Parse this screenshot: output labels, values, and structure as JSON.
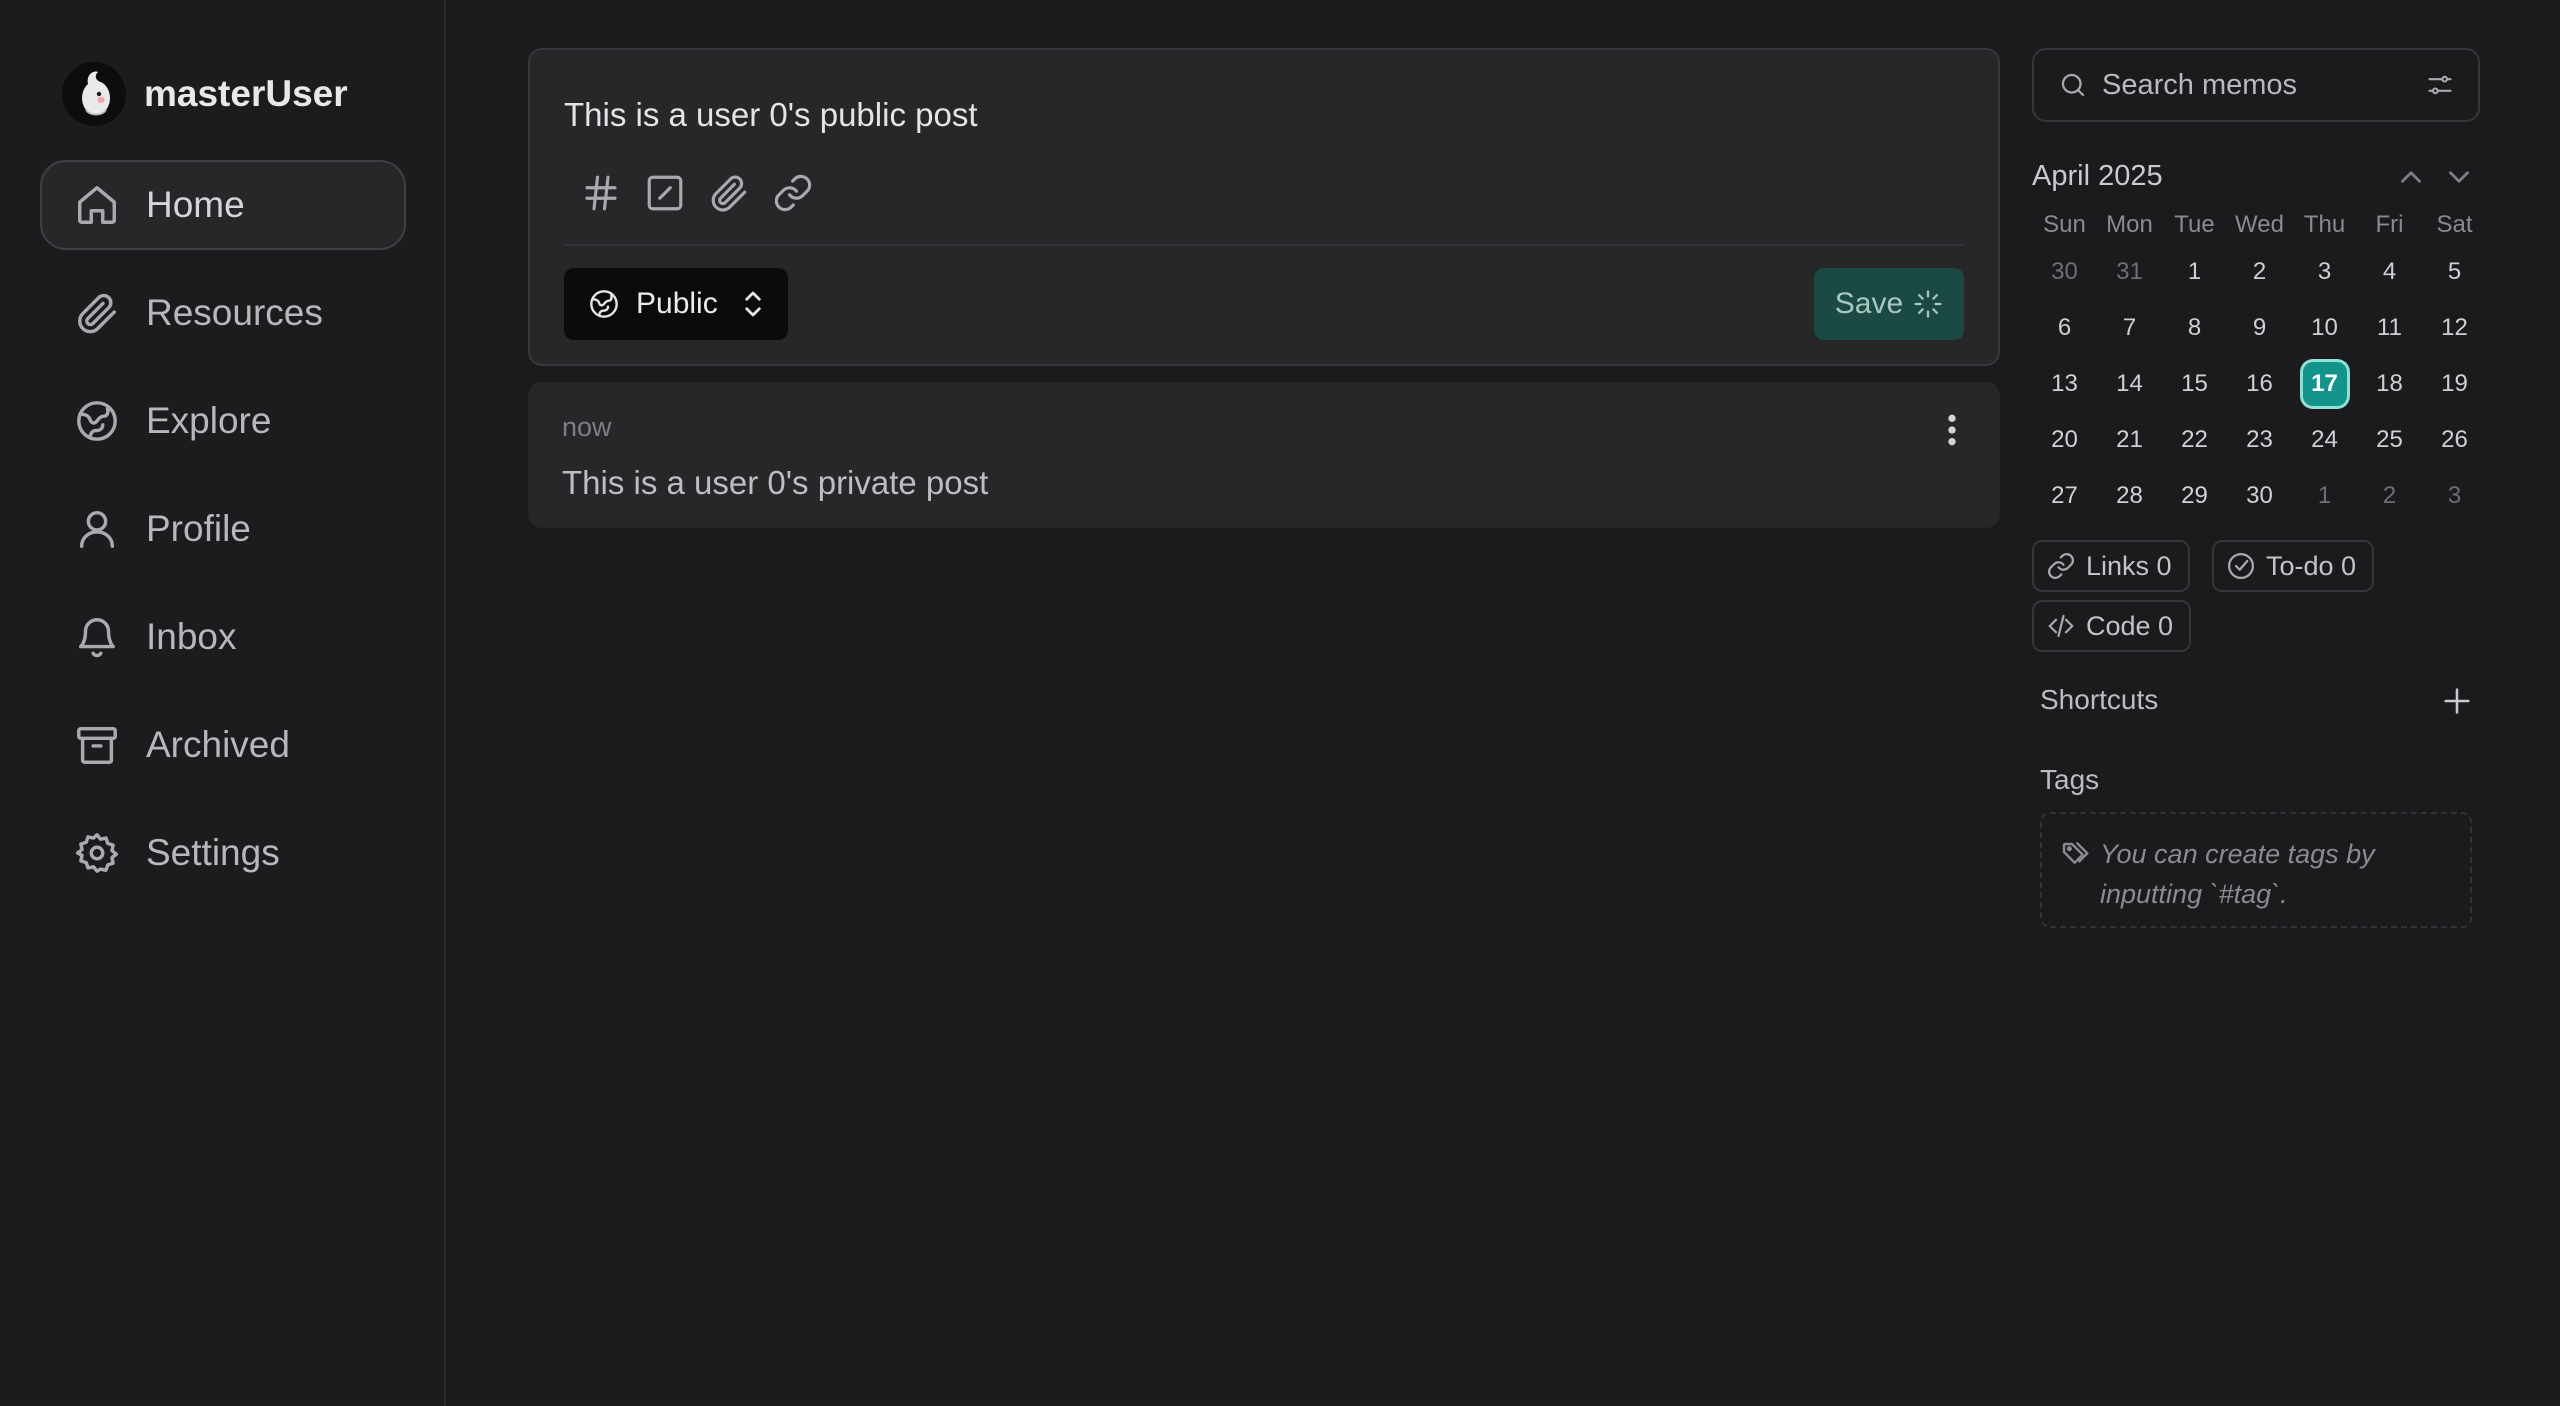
{
  "user": {
    "name": "masterUser"
  },
  "nav": {
    "items": [
      {
        "label": "Home",
        "icon": "home-icon",
        "active": true
      },
      {
        "label": "Resources",
        "icon": "paperclip-icon",
        "active": false
      },
      {
        "label": "Explore",
        "icon": "globe-icon",
        "active": false
      },
      {
        "label": "Profile",
        "icon": "user-icon",
        "active": false
      },
      {
        "label": "Inbox",
        "icon": "bell-icon",
        "active": false
      },
      {
        "label": "Archived",
        "icon": "archive-icon",
        "active": false
      },
      {
        "label": "Settings",
        "icon": "gear-icon",
        "active": false
      }
    ]
  },
  "editor": {
    "content": "This is a user 0's public post",
    "visibility": "Public",
    "save_label": "Save",
    "tools": [
      "hash-icon",
      "checkbox-icon",
      "paperclip-icon",
      "link-icon"
    ]
  },
  "memos": [
    {
      "time": "now",
      "content": "This is a user 0's private post"
    }
  ],
  "search": {
    "placeholder": "Search memos"
  },
  "calendar": {
    "title": "April 2025",
    "weekdays": [
      "Sun",
      "Mon",
      "Tue",
      "Wed",
      "Thu",
      "Fri",
      "Sat"
    ],
    "weeks": [
      [
        "30",
        "31",
        "1",
        "2",
        "3",
        "4",
        "5"
      ],
      [
        "6",
        "7",
        "8",
        "9",
        "10",
        "11",
        "12"
      ],
      [
        "13",
        "14",
        "15",
        "16",
        "17",
        "18",
        "19"
      ],
      [
        "20",
        "21",
        "22",
        "23",
        "24",
        "25",
        "26"
      ],
      [
        "27",
        "28",
        "29",
        "30",
        "1",
        "2",
        "3"
      ]
    ],
    "today": "17"
  },
  "stats": {
    "links": "Links 0",
    "todo": "To-do 0",
    "code": "Code 0"
  },
  "shortcuts": {
    "title": "Shortcuts"
  },
  "tags": {
    "title": "Tags",
    "empty_line1": "You can create tags by",
    "empty_line2": "inputting `#tag`."
  },
  "colors": {
    "accent": "#13948a",
    "save_bg": "#1b4a44",
    "background": "#1b1b1d",
    "card": "#27272a"
  }
}
